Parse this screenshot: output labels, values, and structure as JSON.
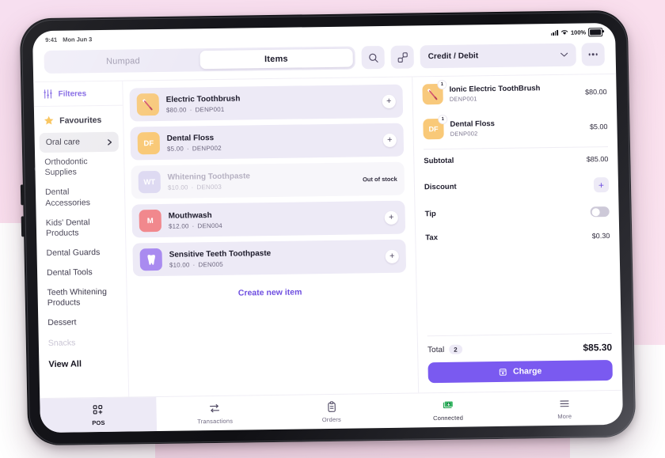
{
  "statusbar": {
    "time": "9:41",
    "date": "Mon Jun 3",
    "battery": "100%",
    "signal_icon": "cellular-signal-icon",
    "wifi_icon": "wifi-icon",
    "battery_icon": "battery-icon"
  },
  "toolbar": {
    "tab_numpad": "Numpad",
    "tab_items": "Items",
    "search_icon": "search-icon",
    "expand_icon": "expand-icon",
    "payment_method": "Credit / Debit",
    "more_icon": "more-dots-icon",
    "chevron_icon": "chevron-down-icon"
  },
  "sidebar": {
    "filters_label": "Filteres",
    "filters_icon": "sliders-icon",
    "favourites_label": "Favourites",
    "favourites_icon": "star-icon",
    "categories": [
      {
        "label": "Oral care",
        "selected": true,
        "dim": false
      },
      {
        "label": "Orthodontic Supplies",
        "selected": false,
        "dim": false
      },
      {
        "label": "Dental Accessories",
        "selected": false,
        "dim": false
      },
      {
        "label": "Kids' Dental Products",
        "selected": false,
        "dim": false
      },
      {
        "label": "Dental Guards",
        "selected": false,
        "dim": false
      },
      {
        "label": "Dental Tools",
        "selected": false,
        "dim": false
      },
      {
        "label": "Teeth Whitening Products",
        "selected": false,
        "dim": false
      },
      {
        "label": "Dessert",
        "selected": false,
        "dim": false
      },
      {
        "label": "Snacks",
        "selected": false,
        "dim": true
      }
    ],
    "view_all": "View All"
  },
  "items": {
    "list": [
      {
        "name": "Electric Toothbrush",
        "price": "$80.00",
        "sku": "DENP001",
        "sep": "·",
        "initials": "",
        "thumb_color": "#f8c97c",
        "thumb_icon": "toothbrush-icon",
        "out_of_stock": false,
        "add_icon": "plus-icon"
      },
      {
        "name": "Dental Floss",
        "price": "$5.00",
        "sku": "DENP002",
        "sep": "·",
        "initials": "DF",
        "thumb_color": "#f9c978",
        "thumb_icon": "",
        "out_of_stock": false,
        "add_icon": "plus-icon"
      },
      {
        "name": "Whitening Toothpaste",
        "price": "$10.00",
        "sku": "DEN003",
        "sep": "·",
        "initials": "WT",
        "thumb_color": "#dedaf2",
        "thumb_icon": "",
        "out_of_stock": true,
        "out_of_stock_label": "Out of stock",
        "add_icon": ""
      },
      {
        "name": "Mouthwash",
        "price": "$12.00",
        "sku": "DEN004",
        "sep": "·",
        "initials": "M",
        "thumb_color": "#f1888d",
        "thumb_icon": "",
        "out_of_stock": false,
        "add_icon": "plus-icon"
      },
      {
        "name": "Sensitive Teeth Toothpaste",
        "price": "$10.00",
        "sku": "DEN005",
        "sep": "·",
        "initials": "",
        "thumb_color": "#a98bf0",
        "thumb_icon": "tooth-icon",
        "out_of_stock": false,
        "add_icon": "plus-icon"
      }
    ],
    "create_new": "Create new item"
  },
  "cart": {
    "lines": [
      {
        "name": "Ionic Electric ToothBrush",
        "sku": "DENP001",
        "amount": "$80.00",
        "qty": "1",
        "initials": "",
        "thumb_color": "#f8c97c",
        "thumb_icon": "toothbrush-icon"
      },
      {
        "name": "Dental Floss",
        "sku": "DENP002",
        "amount": "$5.00",
        "qty": "1",
        "initials": "DF",
        "thumb_color": "#f9c978",
        "thumb_icon": ""
      }
    ],
    "subtotal_label": "Subtotal",
    "subtotal_value": "$85.00",
    "discount_label": "Discount",
    "discount_add_icon": "plus-icon",
    "tip_label": "Tip",
    "tip_toggle_state": "off",
    "tax_label": "Tax",
    "tax_value": "$0.30",
    "total_label": "Total",
    "total_count": "2",
    "total_value": "$85.30",
    "charge_label": "Charge",
    "charge_icon": "card-terminal-icon"
  },
  "nav": {
    "items": [
      {
        "label": "POS",
        "icon": "pos-grid-icon",
        "active": true
      },
      {
        "label": "Transactions",
        "icon": "transfer-arrows-icon",
        "active": false
      },
      {
        "label": "Orders",
        "icon": "clipboard-icon",
        "active": false
      },
      {
        "label": "Connected",
        "icon": "money-icon",
        "active": false
      },
      {
        "label": "More",
        "icon": "hamburger-icon",
        "active": false
      }
    ]
  },
  "colors": {
    "accent": "#7a5af0",
    "accent_soft": "#edeaf6",
    "connected_green": "#2aa455",
    "star": "#f8b93c",
    "text_dark": "#1d1b2b",
    "background_pink": "#fadfee"
  }
}
